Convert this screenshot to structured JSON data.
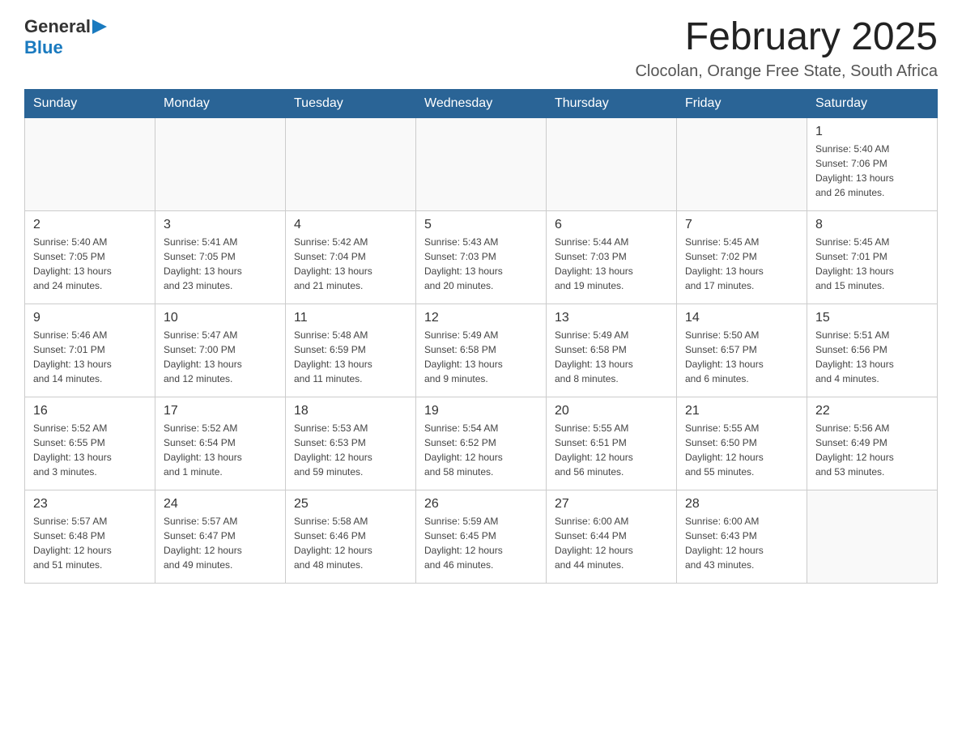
{
  "header": {
    "logo": {
      "general": "General",
      "blue": "Blue"
    },
    "title": "February 2025",
    "subtitle": "Clocolan, Orange Free State, South Africa"
  },
  "days_of_week": [
    "Sunday",
    "Monday",
    "Tuesday",
    "Wednesday",
    "Thursday",
    "Friday",
    "Saturday"
  ],
  "weeks": [
    {
      "days": [
        {
          "date": "",
          "info": ""
        },
        {
          "date": "",
          "info": ""
        },
        {
          "date": "",
          "info": ""
        },
        {
          "date": "",
          "info": ""
        },
        {
          "date": "",
          "info": ""
        },
        {
          "date": "",
          "info": ""
        },
        {
          "date": "1",
          "info": "Sunrise: 5:40 AM\nSunset: 7:06 PM\nDaylight: 13 hours\nand 26 minutes."
        }
      ]
    },
    {
      "days": [
        {
          "date": "2",
          "info": "Sunrise: 5:40 AM\nSunset: 7:05 PM\nDaylight: 13 hours\nand 24 minutes."
        },
        {
          "date": "3",
          "info": "Sunrise: 5:41 AM\nSunset: 7:05 PM\nDaylight: 13 hours\nand 23 minutes."
        },
        {
          "date": "4",
          "info": "Sunrise: 5:42 AM\nSunset: 7:04 PM\nDaylight: 13 hours\nand 21 minutes."
        },
        {
          "date": "5",
          "info": "Sunrise: 5:43 AM\nSunset: 7:03 PM\nDaylight: 13 hours\nand 20 minutes."
        },
        {
          "date": "6",
          "info": "Sunrise: 5:44 AM\nSunset: 7:03 PM\nDaylight: 13 hours\nand 19 minutes."
        },
        {
          "date": "7",
          "info": "Sunrise: 5:45 AM\nSunset: 7:02 PM\nDaylight: 13 hours\nand 17 minutes."
        },
        {
          "date": "8",
          "info": "Sunrise: 5:45 AM\nSunset: 7:01 PM\nDaylight: 13 hours\nand 15 minutes."
        }
      ]
    },
    {
      "days": [
        {
          "date": "9",
          "info": "Sunrise: 5:46 AM\nSunset: 7:01 PM\nDaylight: 13 hours\nand 14 minutes."
        },
        {
          "date": "10",
          "info": "Sunrise: 5:47 AM\nSunset: 7:00 PM\nDaylight: 13 hours\nand 12 minutes."
        },
        {
          "date": "11",
          "info": "Sunrise: 5:48 AM\nSunset: 6:59 PM\nDaylight: 13 hours\nand 11 minutes."
        },
        {
          "date": "12",
          "info": "Sunrise: 5:49 AM\nSunset: 6:58 PM\nDaylight: 13 hours\nand 9 minutes."
        },
        {
          "date": "13",
          "info": "Sunrise: 5:49 AM\nSunset: 6:58 PM\nDaylight: 13 hours\nand 8 minutes."
        },
        {
          "date": "14",
          "info": "Sunrise: 5:50 AM\nSunset: 6:57 PM\nDaylight: 13 hours\nand 6 minutes."
        },
        {
          "date": "15",
          "info": "Sunrise: 5:51 AM\nSunset: 6:56 PM\nDaylight: 13 hours\nand 4 minutes."
        }
      ]
    },
    {
      "days": [
        {
          "date": "16",
          "info": "Sunrise: 5:52 AM\nSunset: 6:55 PM\nDaylight: 13 hours\nand 3 minutes."
        },
        {
          "date": "17",
          "info": "Sunrise: 5:52 AM\nSunset: 6:54 PM\nDaylight: 13 hours\nand 1 minute."
        },
        {
          "date": "18",
          "info": "Sunrise: 5:53 AM\nSunset: 6:53 PM\nDaylight: 12 hours\nand 59 minutes."
        },
        {
          "date": "19",
          "info": "Sunrise: 5:54 AM\nSunset: 6:52 PM\nDaylight: 12 hours\nand 58 minutes."
        },
        {
          "date": "20",
          "info": "Sunrise: 5:55 AM\nSunset: 6:51 PM\nDaylight: 12 hours\nand 56 minutes."
        },
        {
          "date": "21",
          "info": "Sunrise: 5:55 AM\nSunset: 6:50 PM\nDaylight: 12 hours\nand 55 minutes."
        },
        {
          "date": "22",
          "info": "Sunrise: 5:56 AM\nSunset: 6:49 PM\nDaylight: 12 hours\nand 53 minutes."
        }
      ]
    },
    {
      "days": [
        {
          "date": "23",
          "info": "Sunrise: 5:57 AM\nSunset: 6:48 PM\nDaylight: 12 hours\nand 51 minutes."
        },
        {
          "date": "24",
          "info": "Sunrise: 5:57 AM\nSunset: 6:47 PM\nDaylight: 12 hours\nand 49 minutes."
        },
        {
          "date": "25",
          "info": "Sunrise: 5:58 AM\nSunset: 6:46 PM\nDaylight: 12 hours\nand 48 minutes."
        },
        {
          "date": "26",
          "info": "Sunrise: 5:59 AM\nSunset: 6:45 PM\nDaylight: 12 hours\nand 46 minutes."
        },
        {
          "date": "27",
          "info": "Sunrise: 6:00 AM\nSunset: 6:44 PM\nDaylight: 12 hours\nand 44 minutes."
        },
        {
          "date": "28",
          "info": "Sunrise: 6:00 AM\nSunset: 6:43 PM\nDaylight: 12 hours\nand 43 minutes."
        },
        {
          "date": "",
          "info": ""
        }
      ]
    }
  ]
}
